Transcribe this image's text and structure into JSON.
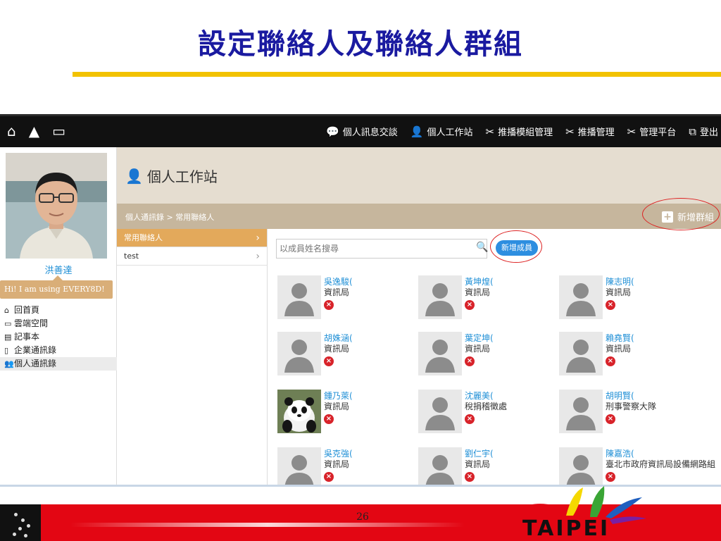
{
  "slide": {
    "title": "設定聯絡人及聯絡人群組",
    "page_number": "26",
    "logo_text": "TAIPEI"
  },
  "topbar": {
    "nav": [
      {
        "icon": "chat-icon",
        "label": "個人訊息交談"
      },
      {
        "icon": "user-icon",
        "label": "個人工作站"
      },
      {
        "icon": "tools-icon",
        "label": "推播模組管理"
      },
      {
        "icon": "tools-icon",
        "label": "推播管理"
      },
      {
        "icon": "tools-icon",
        "label": "管理平台"
      },
      {
        "icon": "logout-icon",
        "label": "登出"
      }
    ]
  },
  "sidebar": {
    "user_name": "洪善達",
    "status": "Hi! I am using EVERY8D!",
    "menu": [
      {
        "icon": "home-icon",
        "label": "回首頁"
      },
      {
        "icon": "cloud-icon",
        "label": "雲端空間"
      },
      {
        "icon": "notebook-icon",
        "label": "記事本"
      },
      {
        "icon": "phone-icon",
        "label": "企業通訊錄"
      },
      {
        "icon": "contacts-icon",
        "label": "個人通訊錄"
      }
    ]
  },
  "header": {
    "title": "個人工作站",
    "breadcrumb": "個人通訊錄 > 常用聯絡人",
    "add_group_label": "新增群組"
  },
  "groups": [
    {
      "label": "常用聯絡人"
    },
    {
      "label": "test"
    }
  ],
  "search": {
    "placeholder": "以成員姓名搜尋",
    "add_member_label": "新增成員"
  },
  "contacts": [
    {
      "name": "吳逸駿(",
      "dept": "資訊局"
    },
    {
      "name": "黃坤煌(",
      "dept": "資訊局"
    },
    {
      "name": "陳志明(",
      "dept": "資訊局"
    },
    {
      "name": "胡姝涵(",
      "dept": "資訊局"
    },
    {
      "name": "葉定坤(",
      "dept": "資訊局"
    },
    {
      "name": "賴堯賢(",
      "dept": "資訊局"
    },
    {
      "name": "鍾乃萊(",
      "dept": "資訊局"
    },
    {
      "name": "沈麗美(",
      "dept": "稅捐稽徵處"
    },
    {
      "name": "胡明賢(",
      "dept": "刑事警察大隊"
    },
    {
      "name": "吳克強(",
      "dept": "資訊局"
    },
    {
      "name": "劉仁宇(",
      "dept": "資訊局"
    },
    {
      "name": "陳嘉浩(",
      "dept": "臺北市政府資訊局設備網路組"
    }
  ],
  "colors": {
    "title": "#1a1aa0",
    "rule": "#f2c200",
    "topbar": "#111111",
    "header_band": "#e5ddd0",
    "crumb_band": "#c6b69d",
    "active_group": "#e3a95b",
    "link": "#1f8fd6",
    "remove": "#d8232a",
    "footer": "#e30613"
  }
}
